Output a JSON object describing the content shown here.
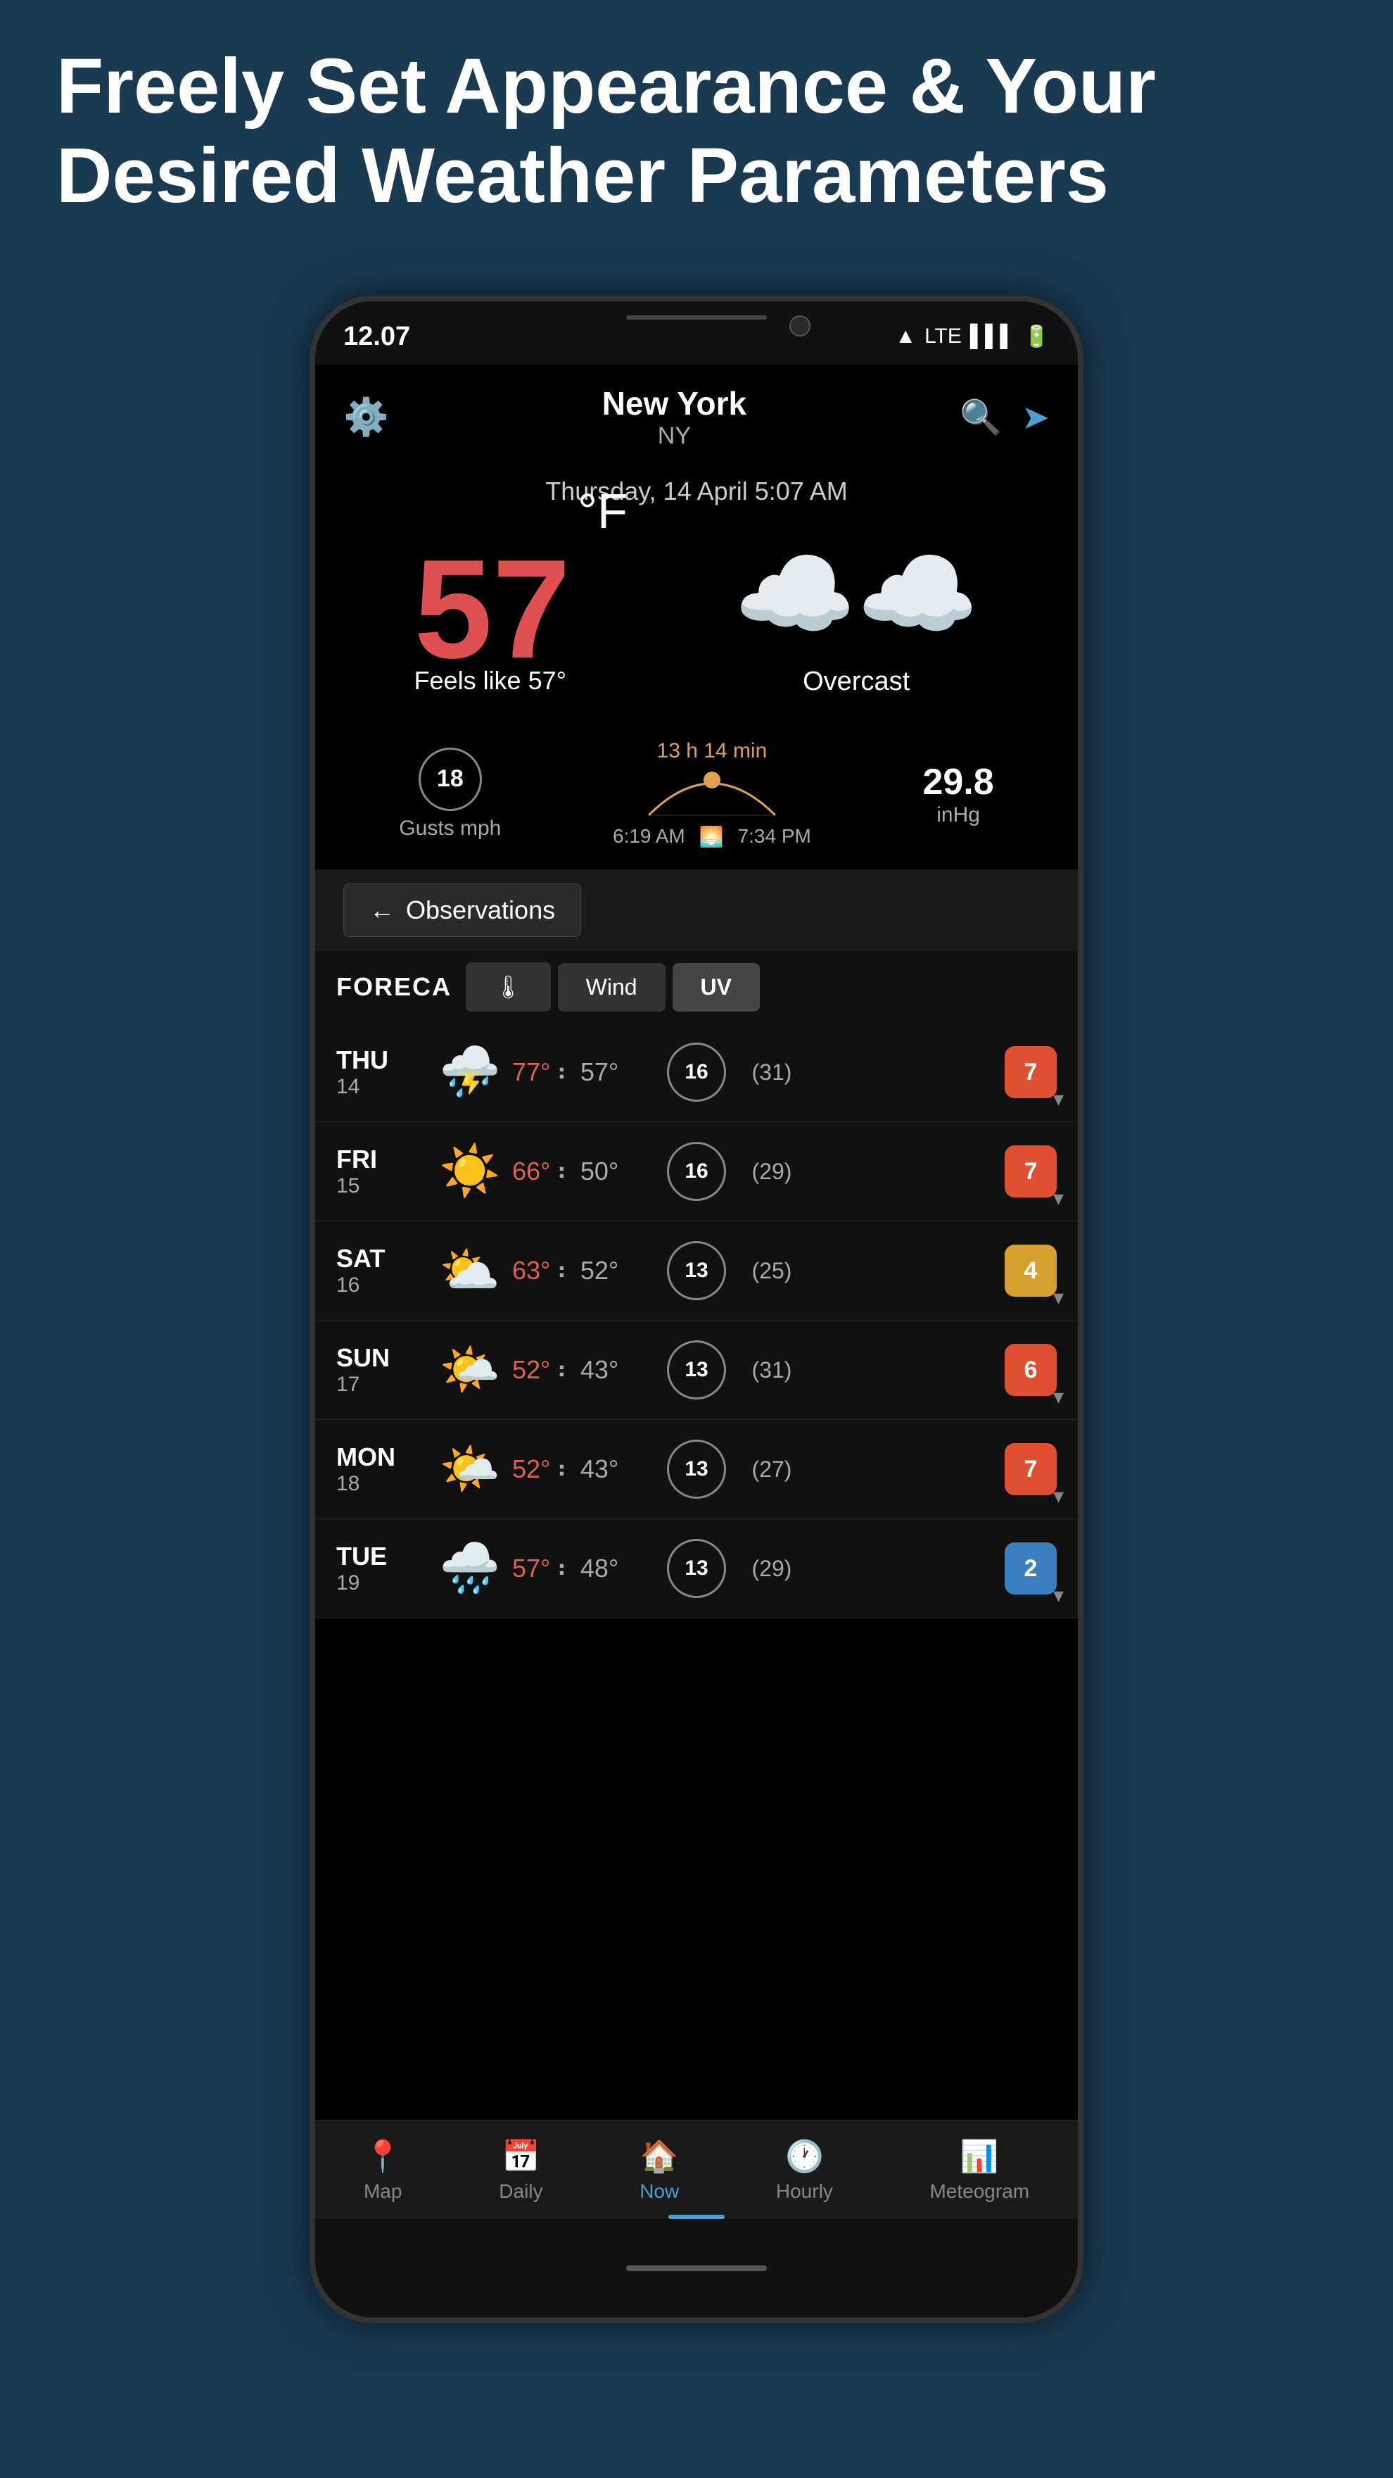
{
  "page": {
    "header_line1": "Freely Set Appearance & Your",
    "header_line2": "Desired Weather Parameters"
  },
  "status_bar": {
    "time": "12.07",
    "network": "LTE"
  },
  "app_header": {
    "city": "New York",
    "state": "NY"
  },
  "date_bar": {
    "text": "Thursday, 14 April 5:07 AM"
  },
  "current_weather": {
    "temperature": "57",
    "unit": "°F",
    "feels_like": "Feels like 57°",
    "description": "Overcast",
    "icon": "☁️"
  },
  "weather_stats": {
    "gusts": "18",
    "gusts_unit": "Gusts mph",
    "sun_duration": "13 h 14 min",
    "sunrise": "6:19 AM",
    "sunset": "7:34 PM",
    "pressure": "29.8",
    "pressure_unit": "inHg"
  },
  "observations_button": {
    "label": "Observations"
  },
  "forecast_tabs": {
    "logo": "FORECA",
    "tabs": [
      "🌡",
      "Wind",
      "UV"
    ]
  },
  "forecast": [
    {
      "day": "THU",
      "date": "14",
      "icon": "⛈️",
      "high": "77°",
      "low": "57°",
      "wind": "16",
      "gust": "(31)",
      "uv": "7",
      "uv_class": "uv-high"
    },
    {
      "day": "FRI",
      "date": "15",
      "icon": "☀️",
      "high": "66°",
      "low": "50°",
      "wind": "16",
      "gust": "(29)",
      "uv": "7",
      "uv_class": "uv-high"
    },
    {
      "day": "SAT",
      "date": "16",
      "icon": "⛅",
      "high": "63°",
      "low": "52°",
      "wind": "13",
      "gust": "(25)",
      "uv": "4",
      "uv_class": "uv-med"
    },
    {
      "day": "SUN",
      "date": "17",
      "icon": "🌤️",
      "high": "52°",
      "low": "43°",
      "wind": "13",
      "gust": "(31)",
      "uv": "6",
      "uv_class": "uv-high"
    },
    {
      "day": "MON",
      "date": "18",
      "icon": "🌤️",
      "high": "52°",
      "low": "43°",
      "wind": "13",
      "gust": "(27)",
      "uv": "7",
      "uv_class": "uv-high"
    },
    {
      "day": "TUE",
      "date": "19",
      "icon": "🌧️",
      "high": "57°",
      "low": "48°",
      "wind": "13",
      "gust": "(29)",
      "uv": "2",
      "uv_class": "uv-low"
    }
  ],
  "bottom_nav": {
    "items": [
      {
        "icon": "📍",
        "label": "Map",
        "active": false
      },
      {
        "icon": "📅",
        "label": "Daily",
        "active": false
      },
      {
        "icon": "🏠",
        "label": "Now",
        "active": true
      },
      {
        "icon": "🕐",
        "label": "Hourly",
        "active": false
      },
      {
        "icon": "📊",
        "label": "Meteogram",
        "active": false
      }
    ]
  }
}
